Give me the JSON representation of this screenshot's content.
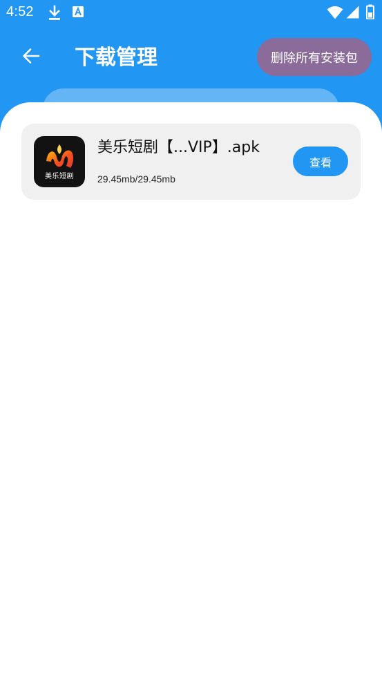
{
  "status_bar": {
    "time": "4:52",
    "icons": [
      "download-icon",
      "a-square-icon",
      "wifi-icon",
      "cell-signal-icon",
      "battery-icon"
    ]
  },
  "toolbar": {
    "back_icon": "arrow-left-icon",
    "title": "下载管理",
    "delete_all_label": "删除所有安装包"
  },
  "downloads": [
    {
      "app_icon_label": "美乐短剧",
      "file_name": "美乐短剧【...VIP】.apk",
      "size": "29.45mb/29.45mb",
      "action_label": "查看"
    }
  ],
  "colors": {
    "primary": "#2196F3",
    "delete_button": "#8B6B9A",
    "item_background": "#F0F0F0"
  }
}
